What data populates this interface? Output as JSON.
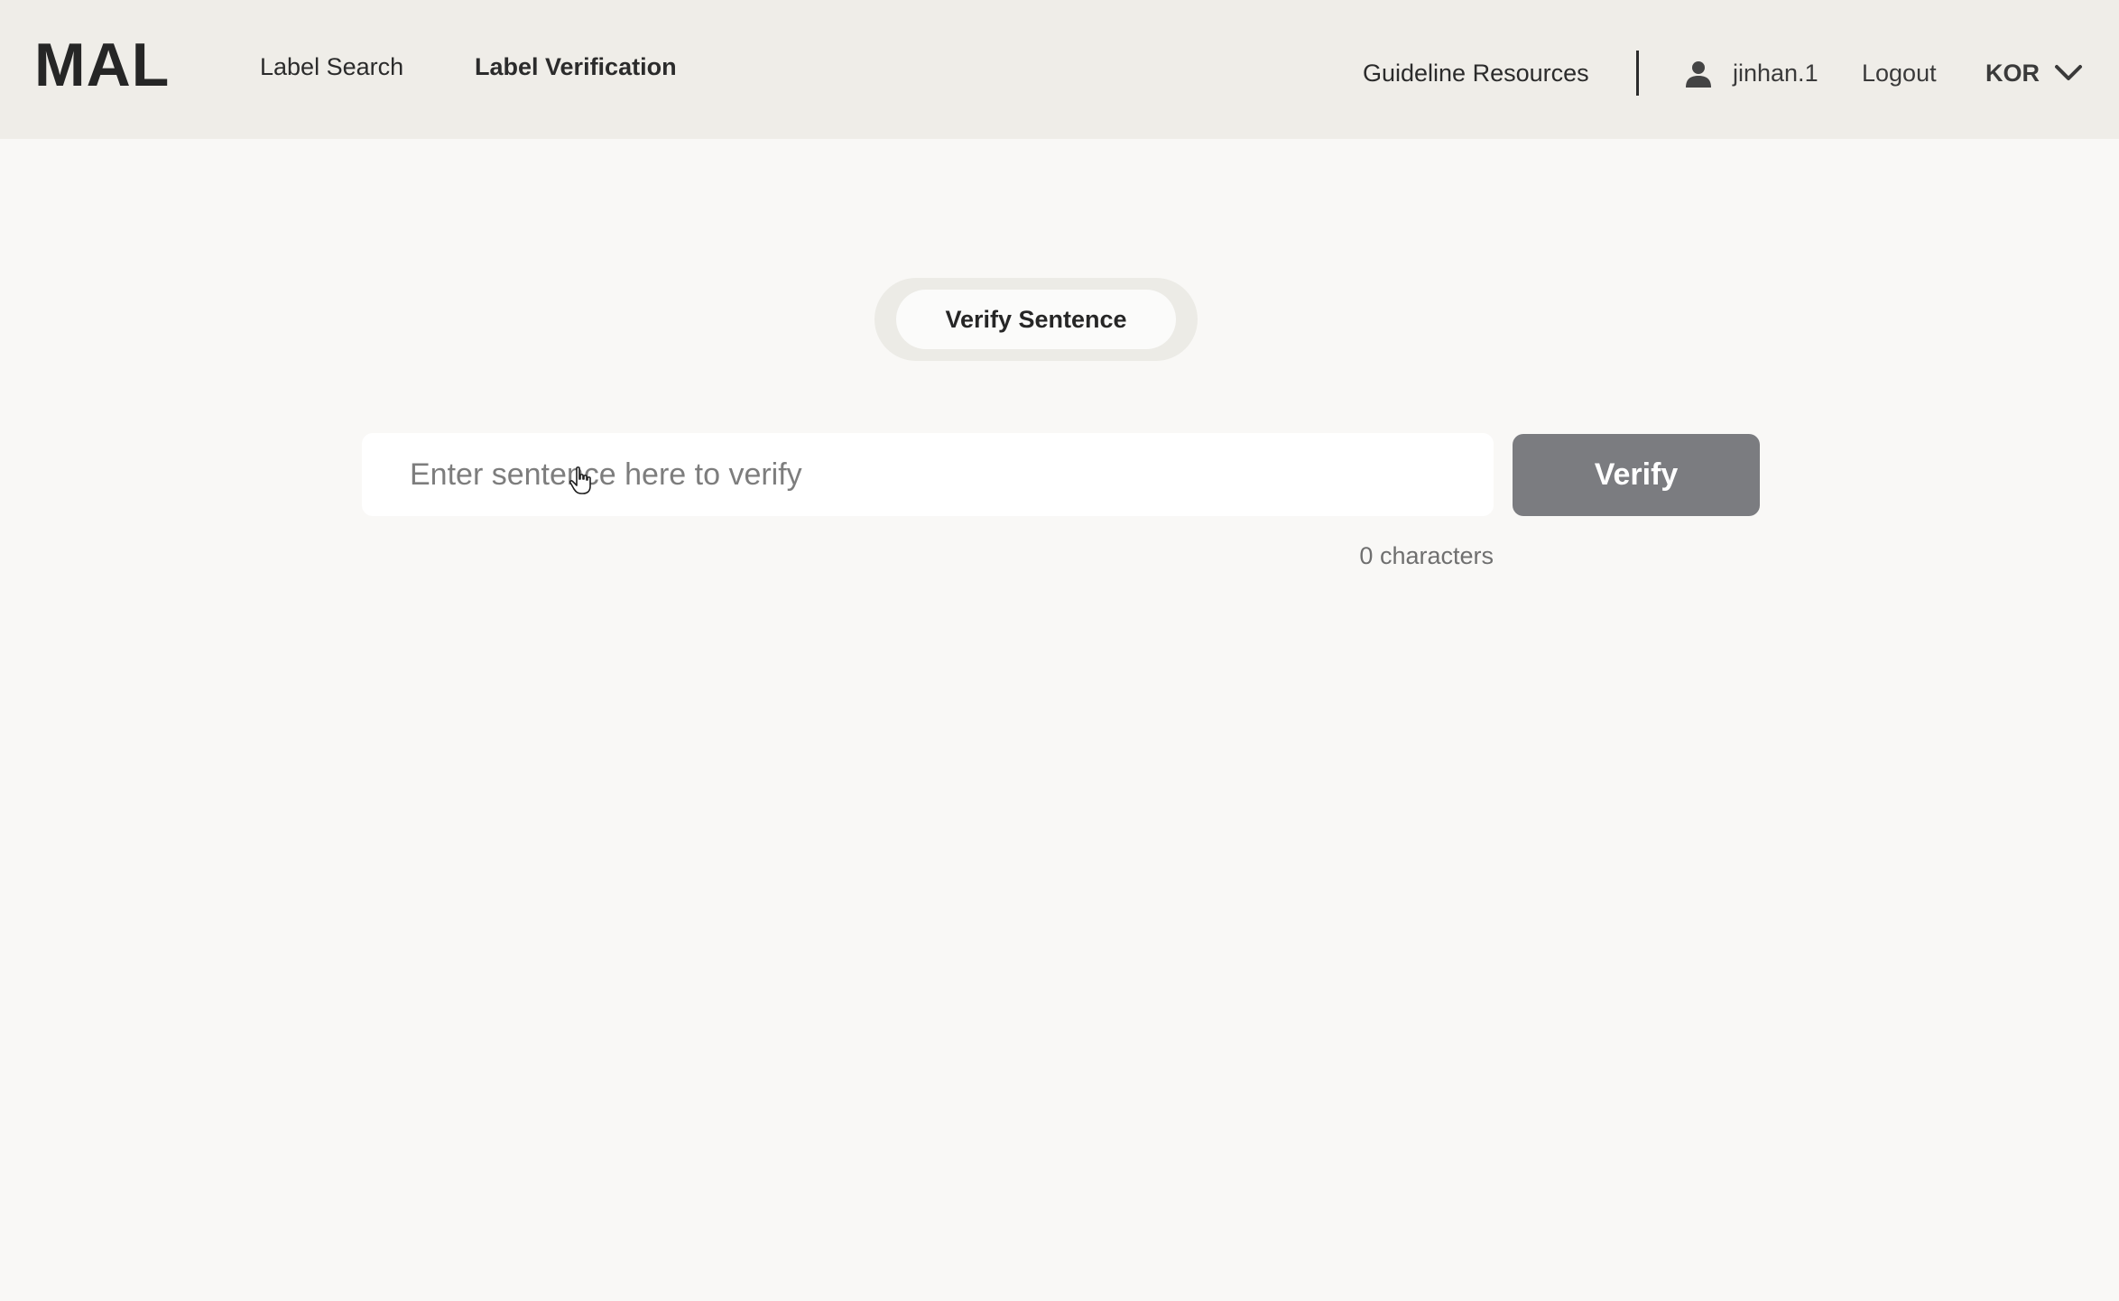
{
  "header": {
    "logo": "MAL",
    "nav": [
      {
        "label": "Label Search"
      },
      {
        "label": "Label Verification"
      }
    ],
    "guideline_label": "Guideline Resources",
    "username": "jinhan.1",
    "logout_label": "Logout",
    "language": "KOR",
    "icons": {
      "user": "user-icon",
      "language_dropdown": "chevron-down-icon"
    }
  },
  "main": {
    "tab": {
      "label": "Verify Sentence"
    },
    "input": {
      "value": "",
      "placeholder": "Enter sentence here to verify"
    },
    "verify_label": "Verify",
    "char_count": "0 characters"
  },
  "colors": {
    "header_bg": "#efede8",
    "page_bg": "#f9f8f6",
    "verify_button": "#7b7c80"
  }
}
